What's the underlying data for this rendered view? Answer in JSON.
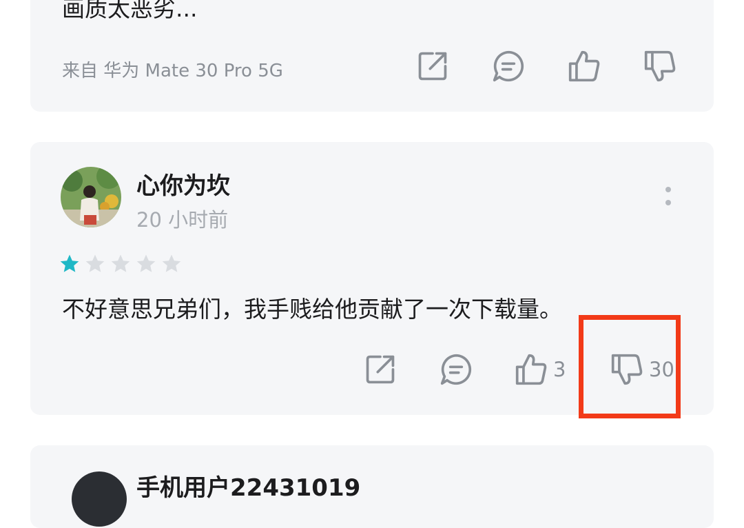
{
  "review_prev": {
    "text_tail": "画质太恶劣...",
    "device": "来自 华为 Mate 30 Pro 5G"
  },
  "review_main": {
    "username": "心你为坎",
    "time": "20 小时前",
    "rating": 1,
    "rating_max": 5,
    "text": "不好意思兄弟们，我手贱给他贡献了一次下载量。",
    "likes": "3",
    "dislikes": "30"
  },
  "review_next": {
    "username": "手机用户22431019"
  },
  "colors": {
    "star_active": "#1fb8c6",
    "star_inactive": "#d9dce0",
    "icon": "#8a8f96",
    "highlight": "#f23a18"
  },
  "icons": {
    "share": "share-icon",
    "comment": "comment-icon",
    "like": "thumb-up-icon",
    "dislike": "thumb-down-icon",
    "more": "more-vertical-icon"
  }
}
